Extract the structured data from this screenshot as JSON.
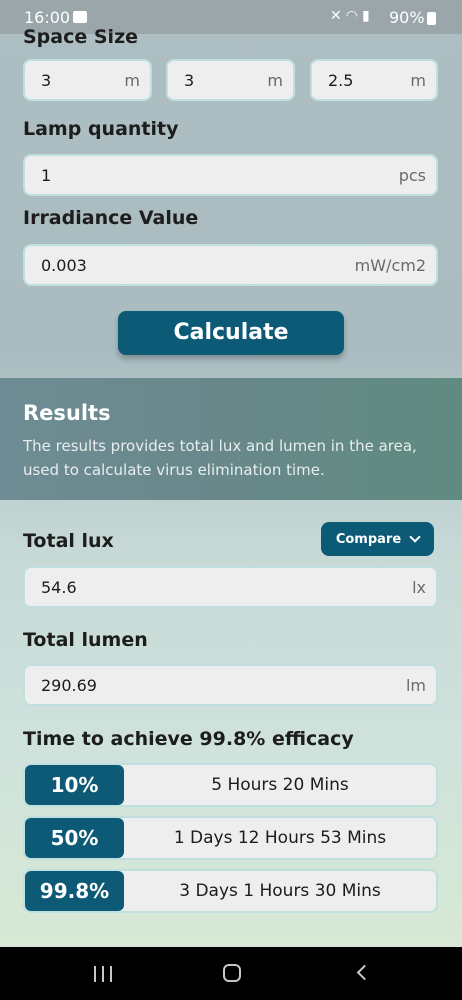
{
  "status_bar": {
    "time": "16:00",
    "battery": "90%",
    "icons": [
      "image-icon",
      "mute-icon",
      "wifi-icon",
      "signal-icon",
      "battery-icon"
    ]
  },
  "space_size": {
    "label": "Space Size",
    "fields": [
      {
        "value": "3",
        "unit": "m"
      },
      {
        "value": "3",
        "unit": "m"
      },
      {
        "value": "2.5",
        "unit": "m"
      }
    ]
  },
  "lamp_quantity": {
    "label": "Lamp quantity",
    "value": "1",
    "unit": "pcs"
  },
  "irradiance": {
    "label": "Irradiance Value",
    "value": "0.003",
    "unit": "mW/cm2"
  },
  "calculate_label": "Calculate",
  "results": {
    "title": "Results",
    "description": "The results provides total lux and lumen in the area, used to calculate virus elimination time."
  },
  "total_lux": {
    "label": "Total lux",
    "value": "54.6",
    "unit": "lx"
  },
  "compare_label": "Compare",
  "total_lumen": {
    "label": "Total lumen",
    "value": "290.69",
    "unit": "lm"
  },
  "efficacy": {
    "label": "Time to achieve 99.8% efficacy",
    "rows": [
      {
        "percent": "10%",
        "duration": "5 Hours 20 Mins"
      },
      {
        "percent": "50%",
        "duration": "1 Days 12 Hours 53 Mins"
      },
      {
        "percent": "99.8%",
        "duration": "3 Days 1 Hours 30 Mins"
      }
    ]
  },
  "colors": {
    "accent": "#0d5a77",
    "field_border": "#bfe0de",
    "results_bg": "#68888a"
  }
}
